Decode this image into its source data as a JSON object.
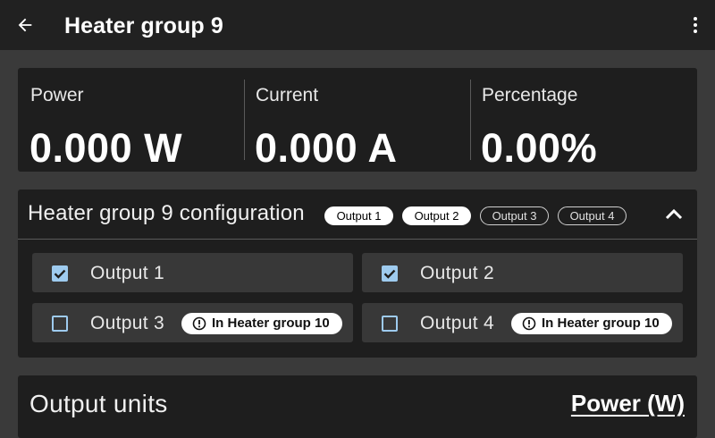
{
  "header": {
    "title": "Heater group 9",
    "back_icon": "arrow-left-icon",
    "menu_icon": "more-vert-icon"
  },
  "stats": [
    {
      "label": "Power",
      "value": "0.000 W"
    },
    {
      "label": "Current",
      "value": "0.000 A"
    },
    {
      "label": "Percentage",
      "value": "0.00%"
    }
  ],
  "config": {
    "title": "Heater group 9 configuration",
    "chips": [
      {
        "label": "Output 1",
        "selected": true
      },
      {
        "label": "Output 2",
        "selected": true
      },
      {
        "label": "Output 3",
        "selected": false
      },
      {
        "label": "Output 4",
        "selected": false
      }
    ],
    "outputs": [
      {
        "label": "Output 1",
        "checked": true,
        "badge": ""
      },
      {
        "label": "Output 2",
        "checked": true,
        "badge": ""
      },
      {
        "label": "Output 3",
        "checked": false,
        "badge": "In Heater group 10"
      },
      {
        "label": "Output 4",
        "checked": false,
        "badge": "In Heater group 10"
      }
    ]
  },
  "units": {
    "label": "Output units",
    "value": "Power (W)"
  },
  "colors": {
    "background": "#3a3a3a",
    "card": "#1e1e1e",
    "header": "#212121",
    "checkbox_accent": "#9ecbef"
  }
}
